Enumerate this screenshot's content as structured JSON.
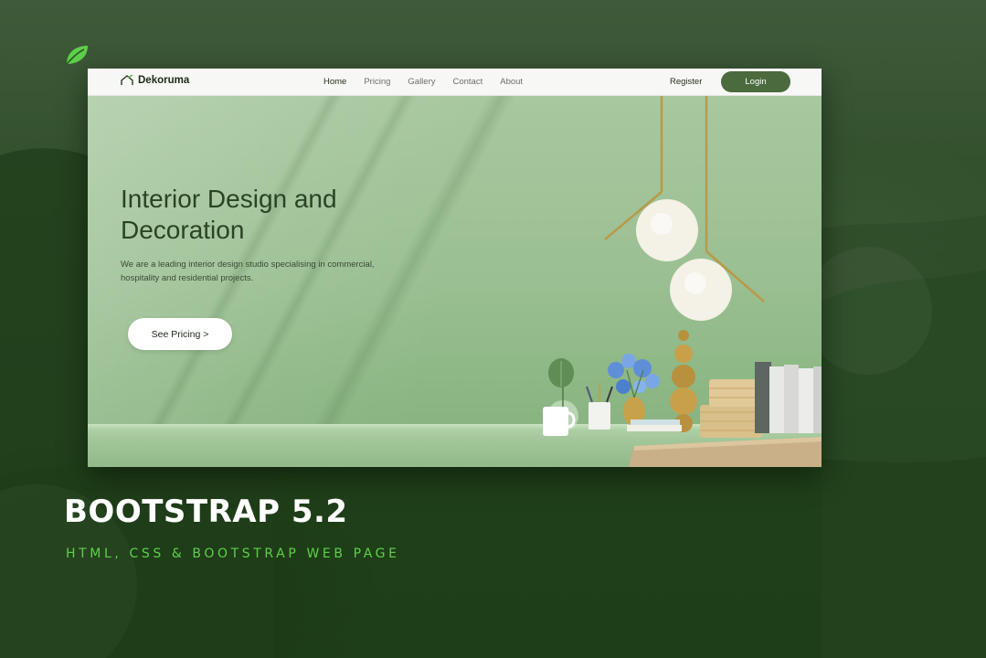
{
  "navbar": {
    "brand": "Dekoruma",
    "links": [
      "Home",
      "Pricing",
      "Gallery",
      "Contact",
      "About"
    ],
    "register": "Register",
    "login": "Login"
  },
  "hero": {
    "title": "Interior Design and Decoration",
    "description": "We are a leading interior design studio specialising in commercial, hospitality and residential projects.",
    "cta": "See Pricing >"
  },
  "banner": {
    "headline": "BOOTSTRAP 5.2",
    "subline": "HTML, CSS & BOOTSTRAP WEB PAGE"
  },
  "colors": {
    "accent_green": "#5fd04b",
    "button_green": "#4b6a3e",
    "hero_green": "#9fc198"
  },
  "icons": [
    "leaf-icon",
    "house-icon"
  ]
}
